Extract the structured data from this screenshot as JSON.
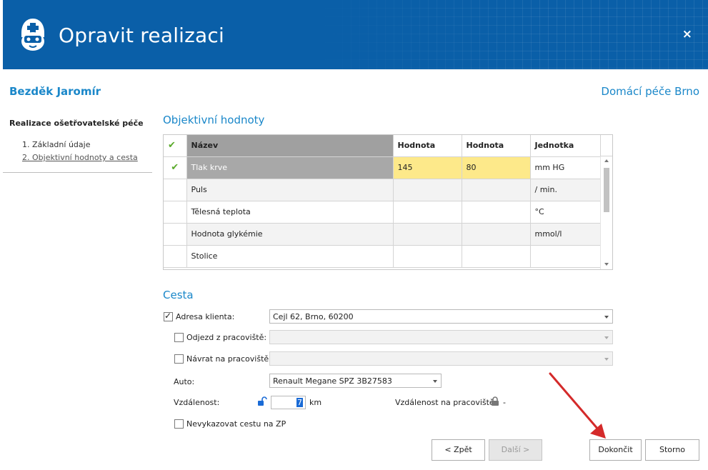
{
  "window": {
    "title": "Opravit realizaci",
    "close_label": "×",
    "icon": "nurse-icon"
  },
  "patient": {
    "name": "Bezděk Jaromír",
    "organization": "Domácí péče Brno"
  },
  "sidebar": {
    "title": "Realizace ošetřovatelské péče",
    "items": [
      {
        "label": "1. Základní údaje",
        "active": false
      },
      {
        "label": "2. Objektivní hodnoty a cesta",
        "active": true
      }
    ]
  },
  "objective": {
    "section_title": "Objektivní hodnoty",
    "columns": [
      "Název",
      "Hodnota",
      "Hodnota",
      "Jednotka"
    ],
    "rows": [
      {
        "checked": true,
        "name": "Tlak krve",
        "value1": "145",
        "value2": "80",
        "unit": "mm HG"
      },
      {
        "checked": false,
        "name": "Puls",
        "value1": "",
        "value2": "",
        "unit": "/ min."
      },
      {
        "checked": false,
        "name": "Tělesná teplota",
        "value1": "",
        "value2": "",
        "unit": "°C"
      },
      {
        "checked": false,
        "name": "Hodnota glykémie",
        "value1": "",
        "value2": "",
        "unit": "mmol/l"
      },
      {
        "checked": false,
        "name": "Stolice",
        "value1": "",
        "value2": "",
        "unit": ""
      }
    ]
  },
  "route": {
    "section_title": "Cesta",
    "client_address": {
      "label": "Adresa klienta:",
      "checked": true,
      "value": "Cejl 62, Brno, 60200"
    },
    "departure": {
      "label": "Odjezd z pracoviště:",
      "checked": false,
      "value": ""
    },
    "return": {
      "label": "Návrat na pracoviště:",
      "checked": false,
      "value": ""
    },
    "car": {
      "label": "Auto:",
      "value": "Renault Megane SPZ 3B27583"
    },
    "distance": {
      "label": "Vzdálenost:",
      "value": "7",
      "unit": "km"
    },
    "workplace_distance": {
      "label": "Vzdálenost na pracoviště:",
      "value": "-"
    },
    "no_report": {
      "label": "Nevykazovat cestu na ZP",
      "checked": false
    }
  },
  "buttons": {
    "back": "< Zpět",
    "next": "Další >",
    "finish": "Dokončit",
    "cancel": "Storno"
  },
  "colors": {
    "header_bg": "#0a5fa8",
    "accent": "#1a87c9",
    "highlight": "#fde98a",
    "check": "#5aaa2a",
    "annotation_arrow": "#d42a2a"
  }
}
